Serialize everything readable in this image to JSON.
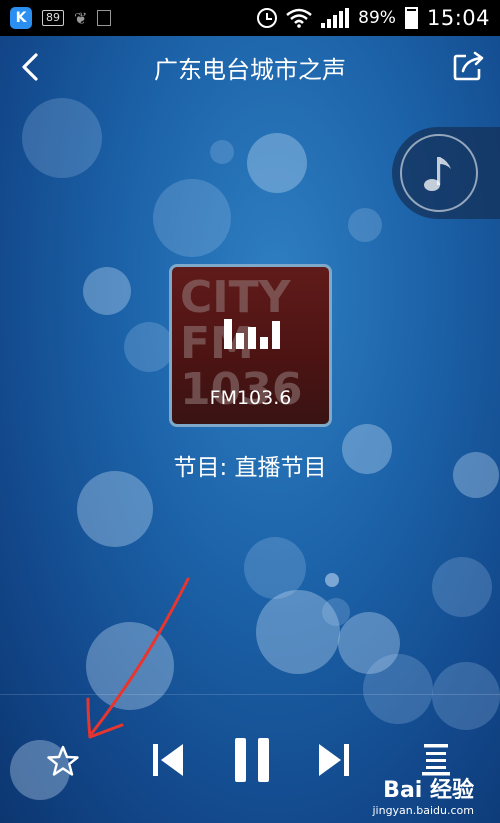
{
  "status_bar": {
    "app_icon_letter": "K",
    "notification_badge": "89",
    "battery_percent": "89%",
    "time": "15:04"
  },
  "header": {
    "title": "广东电台城市之声"
  },
  "now_playing": {
    "cover_text": "CITY FM 1036",
    "frequency": "FM103.6",
    "program": "节目: 直播节目"
  },
  "watermark": {
    "brand": "Bai 经验",
    "url": "jingyan.baidu.com"
  },
  "colors": {
    "background": "#1c62a8",
    "annotation": "#e8362f"
  }
}
